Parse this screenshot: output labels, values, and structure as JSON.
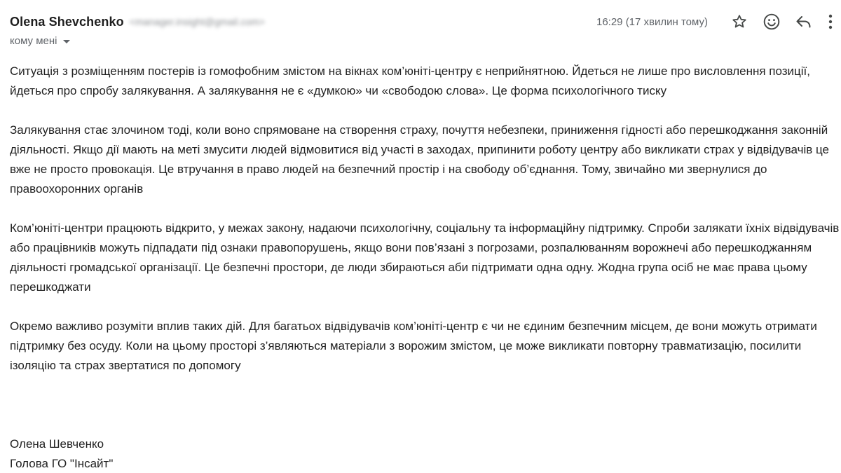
{
  "header": {
    "sender_name": "Olena Shevchenko",
    "sender_email": "<manager.insight@gmail.com>",
    "recipient_label": "кому мені",
    "timestamp": "16:29 (17 хвилин тому)",
    "icons": [
      "star-icon",
      "emoji-icon",
      "reply-icon",
      "more-vert-icon"
    ]
  },
  "body": {
    "paragraphs": [
      "Ситуація з розміщенням постерів із гомофобним змістом на вікнах ком’юніті-центру є неприйнятною. Йдеться не лише про висловлення позиції, йдеться про спробу залякування. А залякування не є «думкою» чи «свободою слова». Це форма психологічного тиску",
      "Залякування стає злочином тоді, коли воно спрямоване на створення страху, почуття небезпеки, приниження гідності або перешкоджання законній діяльності. Якщо дії мають на меті змусити людей відмовитися від участі в заходах, припинити роботу центру або викликати страх у відвідувачів це вже не просто провокація. Це втручання в право людей на безпечний простір і на свободу об’єднання. Тому, звичайно ми звернулися до правоохоронних органів",
      "Ком’юніті-центри працюють відкрито, у межах закону, надаючи психологічну, соціальну та інформаційну підтримку. Спроби залякати їхніх відвідувачів або працівників можуть підпадати під ознаки правопорушень, якщо вони пов’язані з погрозами, розпалюванням ворожнечі або перешкоджанням діяльності громадської організації. Це безпечні простори, де люди збираються аби підтримати одна одну. Жодна група осіб не має права цьому перешкоджати",
      "Окремо важливо розуміти вплив таких дій. Для багатьох відвідувачів ком’юніті-центр є чи не єдиним безпечним місцем, де вони можуть отримати підтримку без осуду. Коли на цьому просторі з’являються матеріали з ворожим змістом, це може викликати повторну травматизацію, посилити ізоляцію та страх звертатися по допомогу"
    ]
  },
  "signature": {
    "name": "Олена Шевченко",
    "title": "Голова ГО \"Інсайт\""
  }
}
